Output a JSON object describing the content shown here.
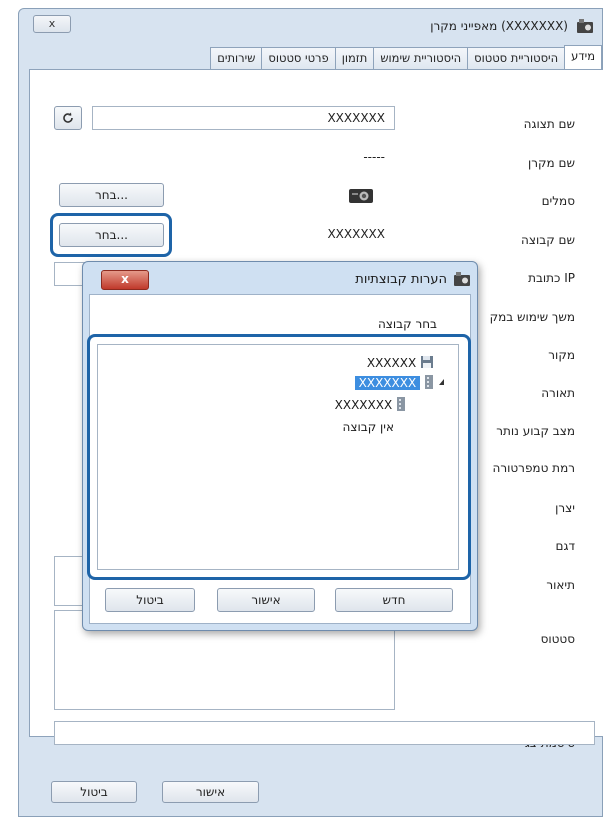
{
  "window": {
    "title": "מאפייני מקרן (XXXXXXX)",
    "close_label": "x",
    "tabs": [
      "מידע",
      "היסטוריית סטטוס",
      "היסטוריית שימוש",
      "תזמון",
      "פרטי סטטוס",
      "שירותים"
    ],
    "active_tab": "מידע"
  },
  "form": {
    "display_name_label": "שם תצוגה",
    "display_name_value": "XXXXXXX",
    "projector_name_label": "שם מקרן",
    "projector_name_value": "-----",
    "icons_label": "סמלים",
    "group_name_label": "שם קבוצה",
    "group_name_value": "XXXXXXX",
    "select_button_label": "בחר...",
    "ip_label": "כתובת IP",
    "usage_label": "משך שימוש במק",
    "source_label": "מקור",
    "lighting_label": "תאורה",
    "shutter_label": "מצב קבוע נותר",
    "temperature_label": "רמת טמפרטורה",
    "manufacturer_label": "יצרן",
    "model_label": "דגם",
    "description_label": "תיאור",
    "status_label": "סטטוס",
    "display_password_label": "סיסמת צג",
    "ok_label": "אישור",
    "cancel_label": "ביטול"
  },
  "dialog": {
    "title": "הערות קבוצתיות",
    "close_label": "x",
    "select_group_label": "בחר קבוצה",
    "tree": [
      {
        "label": "XXXXXX",
        "icon": "floppy-icon",
        "selected": false
      },
      {
        "label": "XXXXXXX",
        "icon": "building-icon",
        "selected": true
      },
      {
        "label": "XXXXXXX",
        "icon": "building-icon",
        "selected": false
      },
      {
        "label": "אין קבוצה",
        "icon": "",
        "selected": false
      }
    ],
    "new_label": "חדש",
    "ok_label": "אישור",
    "cancel_label": "ביטול"
  },
  "colors": {
    "highlight": "#1e64a8",
    "selection": "#3d8ee0",
    "dialog_close": "#c0392b"
  }
}
